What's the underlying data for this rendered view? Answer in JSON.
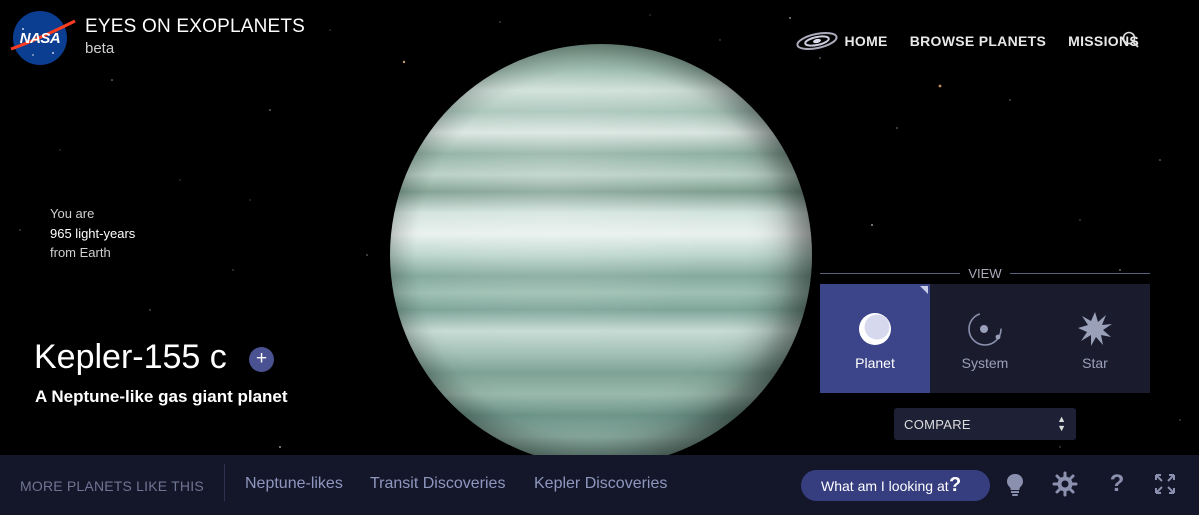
{
  "header": {
    "logo_text": "NASA",
    "title": "EYES ON EXOPLANETS",
    "subtitle": "beta"
  },
  "nav": {
    "home": "HOME",
    "browse": "BROWSE PLANETS",
    "missions": "MISSIONS",
    "search_icon": "search-icon"
  },
  "distance": {
    "line1": "You are",
    "line2": "965 light-years",
    "line3": "from Earth"
  },
  "planet": {
    "name": "Kepler-155 c",
    "add_label": "+",
    "description": "A Neptune-like gas giant planet"
  },
  "view": {
    "label": "VIEW",
    "options": [
      {
        "label": "Planet",
        "icon": "planet-icon",
        "active": true
      },
      {
        "label": "System",
        "icon": "system-icon",
        "active": false
      },
      {
        "label": "Star",
        "icon": "star-icon",
        "active": false
      }
    ]
  },
  "compare": {
    "label": "COMPARE"
  },
  "bottom_bar": {
    "more_label": "MORE PLANETS LIKE THIS",
    "categories": [
      "Neptune-likes",
      "Transit Discoveries",
      "Kepler Discoveries"
    ],
    "what_button": "What am I looking at",
    "what_q": "?",
    "tools": [
      "lightbulb-icon",
      "gear-icon",
      "help-icon",
      "fullscreen-icon"
    ],
    "help_glyph": "?"
  },
  "colors": {
    "accent": "#3c4589",
    "bar": "#141729",
    "panel": "#1a1c2e"
  }
}
